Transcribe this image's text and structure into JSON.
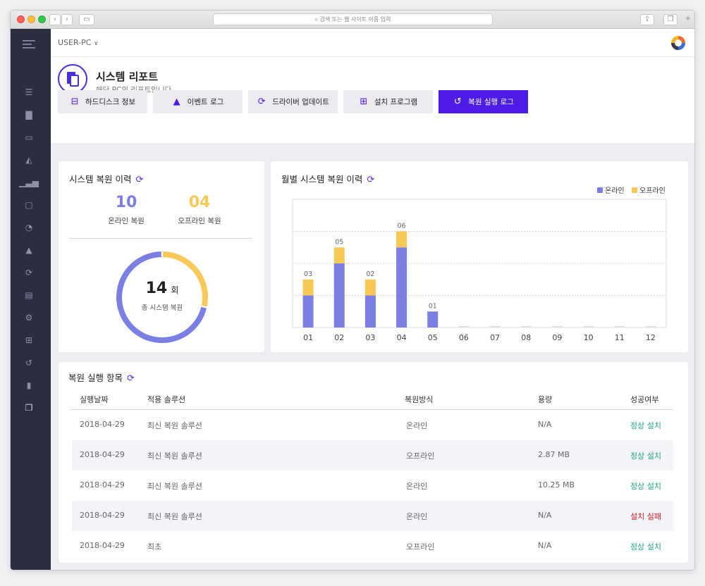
{
  "browser": {
    "url_placeholder": "검색 또는 웹 사이트 이름 입력"
  },
  "topbar": {
    "pc_name": "USER-PC"
  },
  "header": {
    "title": "시스템 리포트",
    "subtitle": "해당 PC의 리포트입니다."
  },
  "tabs": [
    "하드디스크 정보",
    "이벤트 로그",
    "드라이버 업데이트",
    "설치 프로그램",
    "복원 실행 로그"
  ],
  "restore_history": {
    "title": "시스템 복원 이력",
    "online_count": "10",
    "online_label": "온라인 복원",
    "offline_count": "04",
    "offline_label": "오프라인 복원",
    "total": "14",
    "total_unit": "회",
    "total_label": "총 시스템 복원",
    "colors": {
      "online": "#7b7fe3",
      "offline": "#f8c956"
    }
  },
  "monthly": {
    "title": "월별 시스템 복원 이력"
  },
  "chart_data": {
    "type": "bar",
    "categories": [
      "01",
      "02",
      "03",
      "04",
      "05",
      "06",
      "07",
      "08",
      "09",
      "10",
      "11",
      "12"
    ],
    "series": [
      {
        "name": "온라인",
        "values": [
          2,
          4,
          2,
          5,
          1,
          0,
          0,
          0,
          0,
          0,
          0,
          0
        ]
      },
      {
        "name": "오프라인",
        "values": [
          1,
          1,
          1,
          1,
          0,
          0,
          0,
          0,
          0,
          0,
          0,
          0
        ]
      }
    ],
    "data_labels": [
      "03",
      "05",
      "02",
      "06",
      "01",
      "",
      "",
      "",
      "",
      "",
      "",
      ""
    ],
    "stacked": true,
    "legend": "top-right",
    "ymax": 8
  },
  "log": {
    "title": "복원 실행 항목",
    "headers": [
      "실행날짜",
      "적용 솔루션",
      "복원방식",
      "용량",
      "성공여부"
    ],
    "rows": [
      [
        "2018-04-29",
        "최신 복원 솔루션",
        "온라인",
        "N/A",
        "정상 설치"
      ],
      [
        "2018-04-29",
        "최신 복원 솔루션",
        "오프라인",
        "2.87 MB",
        "정상 설치"
      ],
      [
        "2018-04-29",
        "최신 복원 솔루션",
        "온라인",
        "10.25 MB",
        "정상 설치"
      ],
      [
        "2018-04-29",
        "최신 복원 솔루션",
        "온라인",
        "N/A",
        "설치 실패"
      ],
      [
        "2018-04-29",
        "최초",
        "오프라인",
        "N/A",
        "정상 설치"
      ]
    ]
  }
}
